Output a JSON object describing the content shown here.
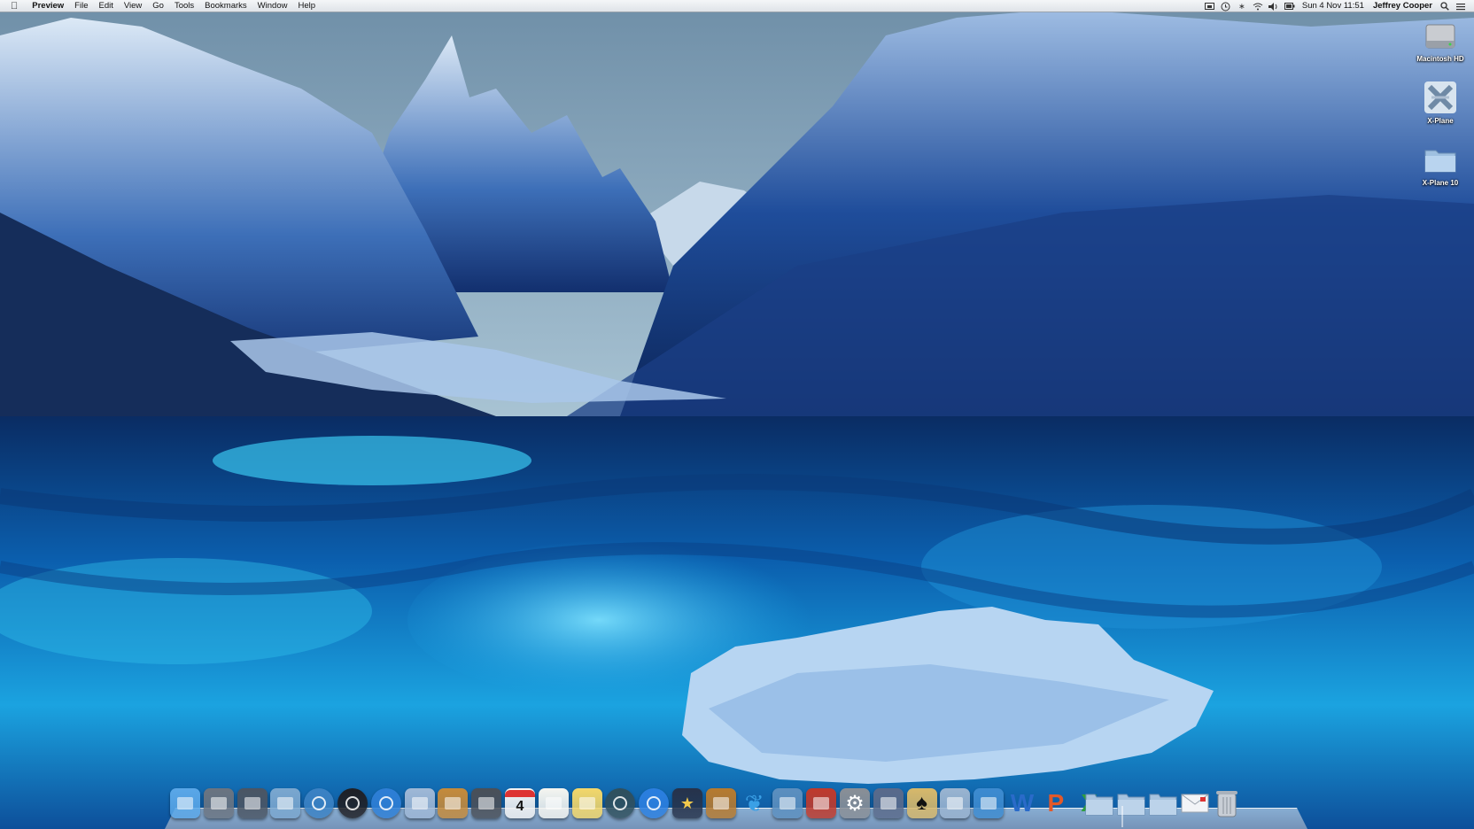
{
  "menubar": {
    "apple_icon": "apple-icon",
    "app_name": "Preview",
    "menus": [
      "File",
      "Edit",
      "View",
      "Go",
      "Tools",
      "Bookmarks",
      "Window",
      "Help"
    ],
    "status_icons": [
      "display-mirroring-icon",
      "time-machine-icon",
      "bluetooth-icon",
      "wifi-icon",
      "volume-icon",
      "battery-icon"
    ],
    "clock": "Sun 4 Nov  11:51",
    "user": "Jeffrey Cooper",
    "spotlight_icon": "spotlight-icon",
    "list_icon": "notification-list-icon"
  },
  "desktop_icons": [
    {
      "label": "Macintosh HD",
      "icon": "hard-drive-icon"
    },
    {
      "label": "X-Plane",
      "icon": "x-plane-app-icon"
    },
    {
      "label": "X-Plane 10",
      "icon": "folder-icon"
    }
  ],
  "dock": {
    "calendar_day": "4",
    "apps": [
      {
        "name": "Finder",
        "icon": "finder-icon",
        "color": "#5aa7e8"
      },
      {
        "name": "Launchpad",
        "icon": "launchpad-icon",
        "color": "#6b7480"
      },
      {
        "name": "Mission Control",
        "icon": "mission-control-icon",
        "color": "#4b5563"
      },
      {
        "name": "Preview",
        "icon": "preview-icon",
        "color": "#7ba7cf"
      },
      {
        "name": "Safari",
        "icon": "safari-icon",
        "color": "#3b82c4"
      },
      {
        "name": "Photo Booth",
        "icon": "photo-booth-icon",
        "color": "#1f1f24"
      },
      {
        "name": "App Store",
        "icon": "app-store-icon",
        "color": "#2e7fd6"
      },
      {
        "name": "Mail",
        "icon": "mail-icon",
        "color": "#9fb8d6"
      },
      {
        "name": "Contacts",
        "icon": "contacts-icon",
        "color": "#c58a3a"
      },
      {
        "name": "FaceTime",
        "icon": "facetime-icon",
        "color": "#4a4f57"
      },
      {
        "name": "Calendar",
        "icon": "calendar-icon",
        "color": "#f3f3f3"
      },
      {
        "name": "Reminders",
        "icon": "reminders-icon",
        "color": "#f5f5f0"
      },
      {
        "name": "Notes",
        "icon": "notes-icon",
        "color": "#f3d76a"
      },
      {
        "name": "Time Machine",
        "icon": "time-machine-app-icon",
        "color": "#2f4f5c"
      },
      {
        "name": "iTunes",
        "icon": "itunes-icon",
        "color": "#2b7fe0"
      },
      {
        "name": "iMovie",
        "icon": "imovie-icon",
        "color": "#26324a"
      },
      {
        "name": "GarageBand",
        "icon": "garageband-icon",
        "color": "#b77a2e"
      },
      {
        "name": "Twitter",
        "icon": "twitter-icon",
        "color": "#3aa0e6"
      },
      {
        "name": "iPhoto",
        "icon": "iphoto-icon",
        "color": "#5c8fbf"
      },
      {
        "name": "Photo Booth Strip",
        "icon": "photo-strip-icon",
        "color": "#c0392b"
      },
      {
        "name": "System Preferences",
        "icon": "system-preferences-icon",
        "color": "#8a8f96"
      },
      {
        "name": "Script Editor",
        "icon": "script-editor-icon",
        "color": "#5a6a8a"
      },
      {
        "name": "Solitaire",
        "icon": "solitaire-icon",
        "color": "#d7b86a"
      },
      {
        "name": "X-Plane",
        "icon": "x-plane-dock-icon",
        "color": "#9ab4d0"
      },
      {
        "name": "Network Utility",
        "icon": "network-icon",
        "color": "#3d8bd0"
      },
      {
        "name": "Word",
        "icon": "word-icon",
        "color": "#2a6bc9"
      },
      {
        "name": "PowerPoint",
        "icon": "powerpoint-icon",
        "color": "#e2592a"
      },
      {
        "name": "Excel",
        "icon": "excel-icon",
        "color": "#2f9e3f"
      }
    ],
    "folders": [
      {
        "name": "Documents",
        "icon": "documents-folder-icon"
      },
      {
        "name": "Downloads",
        "icon": "downloads-folder-icon"
      },
      {
        "name": "Applications",
        "icon": "applications-folder-icon"
      },
      {
        "name": "Mail Stack",
        "icon": "mail-stack-icon"
      },
      {
        "name": "Trash",
        "icon": "trash-icon"
      }
    ]
  }
}
